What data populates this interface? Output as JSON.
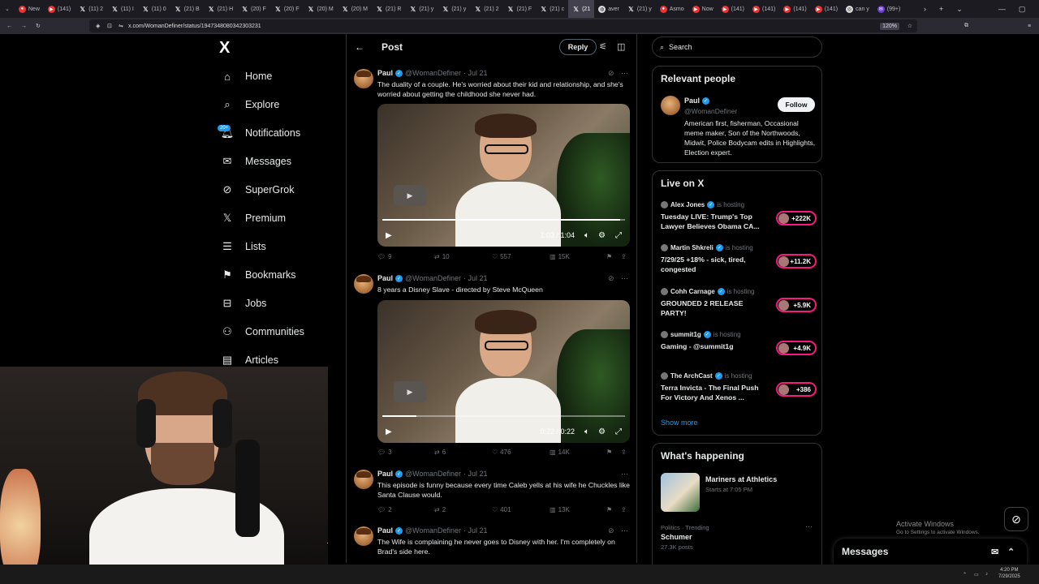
{
  "browser": {
    "tabs": [
      {
        "label": "New",
        "icon": "firefox-icon"
      },
      {
        "label": "(141)",
        "icon": "youtube-icon"
      },
      {
        "label": "(11) 2",
        "icon": "x-icon"
      },
      {
        "label": "(11) I",
        "icon": "x-icon"
      },
      {
        "label": "(11) 0",
        "icon": "x-icon"
      },
      {
        "label": "(21) B",
        "icon": "x-icon"
      },
      {
        "label": "(21) H",
        "icon": "x-icon"
      },
      {
        "label": "(20) F",
        "icon": "x-icon"
      },
      {
        "label": "(20) F",
        "icon": "x-icon"
      },
      {
        "label": "(20) M",
        "icon": "x-icon"
      },
      {
        "label": "(20) M",
        "icon": "x-icon"
      },
      {
        "label": "(21) R",
        "icon": "x-icon"
      },
      {
        "label": "(21) y",
        "icon": "x-icon"
      },
      {
        "label": "(21) y",
        "icon": "x-icon"
      },
      {
        "label": "(21) 2",
        "icon": "x-icon"
      },
      {
        "label": "(21) F",
        "icon": "x-icon"
      },
      {
        "label": "(21) c",
        "icon": "x-icon"
      },
      {
        "label": "(21",
        "icon": "x-icon"
      },
      {
        "label": "aver",
        "icon": "globe-icon"
      },
      {
        "label": "(21) y",
        "icon": "x-icon"
      },
      {
        "label": "Asmo",
        "icon": "reddit-icon"
      },
      {
        "label": "Now",
        "icon": "youtube-icon"
      },
      {
        "label": "(141)",
        "icon": "youtube-icon"
      },
      {
        "label": "(141)",
        "icon": "youtube-icon"
      },
      {
        "label": "(141)",
        "icon": "youtube-icon"
      },
      {
        "label": "(141)",
        "icon": "youtube-icon"
      },
      {
        "label": "can y",
        "icon": "chatgpt-icon"
      },
      {
        "label": "(99+)",
        "icon": "mail-icon"
      }
    ],
    "url": "x.com/WomanDefiner/status/1947348080342303231",
    "zoom": "120%"
  },
  "nav": {
    "logo": "X",
    "badge": "20+",
    "items": [
      {
        "label": "Home",
        "icon": "⌂"
      },
      {
        "label": "Explore",
        "icon": "⌕"
      },
      {
        "label": "Notifications",
        "icon": "🔔︎"
      },
      {
        "label": "Messages",
        "icon": "✉"
      },
      {
        "label": "SuperGrok",
        "icon": "⊘"
      },
      {
        "label": "Premium",
        "icon": "𝕏"
      },
      {
        "label": "Lists",
        "icon": "☰"
      },
      {
        "label": "Bookmarks",
        "icon": "⚑"
      },
      {
        "label": "Jobs",
        "icon": "⊟"
      },
      {
        "label": "Communities",
        "icon": "⚇"
      },
      {
        "label": "Articles",
        "icon": "▤"
      }
    ]
  },
  "post_header": {
    "title": "Post",
    "reply_label": "Reply"
  },
  "tweets": [
    {
      "name": "Paul",
      "handle": "@WomanDefiner",
      "date": "· Jul 21",
      "text": "The duality of a couple. He's worried about their kid and relationship, and she's worried about getting the childhood she never had.",
      "video_time": "1:03 / 1:04",
      "video_progress": 0.98,
      "replies": "9",
      "reposts": "10",
      "likes": "557",
      "views": "15K"
    },
    {
      "name": "Paul",
      "handle": "@WomanDefiner",
      "date": "· Jul 21",
      "text": "8 years a Disney Slave - directed by Steve McQueen",
      "video_time": "0:22 / 0:22",
      "video_progress": 0.14,
      "replies": "3",
      "reposts": "6",
      "likes": "476",
      "views": "14K"
    },
    {
      "name": "Paul",
      "handle": "@WomanDefiner",
      "date": "· Jul 21",
      "text": "This episode is funny because every time Caleb yells at his wife he Chuckles like Santa Clause would.",
      "replies": "2",
      "reposts": "2",
      "likes": "401",
      "views": "13K"
    },
    {
      "name": "Paul",
      "handle": "@WomanDefiner",
      "date": "· Jul 21",
      "text": "The Wife is complaining he never goes to Disney with her. I'm completely on Brad's side here."
    }
  ],
  "search": {
    "placeholder": "Search"
  },
  "relevant_people": {
    "title": "Relevant people",
    "name": "Paul",
    "handle": "@WomanDefiner",
    "follow_label": "Follow",
    "bio": "American first, fisherman, Occasional meme maker, Son of the Northwoods, Midwit, Police Bodycam edits in Highlights, Election expert."
  },
  "live": {
    "title": "Live on X",
    "hosting_label": "is hosting",
    "items": [
      {
        "host": "Alex Jones",
        "title": "Tuesday LIVE: Trump's Top Lawyer Believes Obama CA...",
        "count": "+222K"
      },
      {
        "host": "Martin Shkreli",
        "title": "7/29/25 +18% - sick, tired, congested",
        "count": "+11.2K"
      },
      {
        "host": "Cohh Carnage",
        "title": "GROUNDED 2 RELEASE PARTY!",
        "count": "+5.9K"
      },
      {
        "host": "summit1g",
        "title": "Gaming - @summit1g",
        "count": "+4.9K"
      },
      {
        "host": "The ArchCast",
        "title": "Terra Invicta - The Final Push For Victory And Xenos ...",
        "count": "+386"
      }
    ],
    "show_more": "Show more"
  },
  "whats_happening": {
    "title": "What's happening",
    "event": "Mariners at Athletics",
    "event_time": "Starts at 7:05 PM",
    "trend_context": "Politics · Trending",
    "trend_name": "Schumer",
    "trend_posts": "27.3K posts"
  },
  "messages_dock": {
    "label": "Messages"
  },
  "watermark": {
    "line1": "Activate Windows",
    "line2": "Go to Settings to activate Windows."
  },
  "taskbar": {
    "time": "4:20 PM",
    "date": "7/29/2025"
  },
  "colors": {
    "accent": "#1d9bf0",
    "live_ring": "#f91880",
    "border": "#2f3336",
    "muted": "#71767b"
  }
}
